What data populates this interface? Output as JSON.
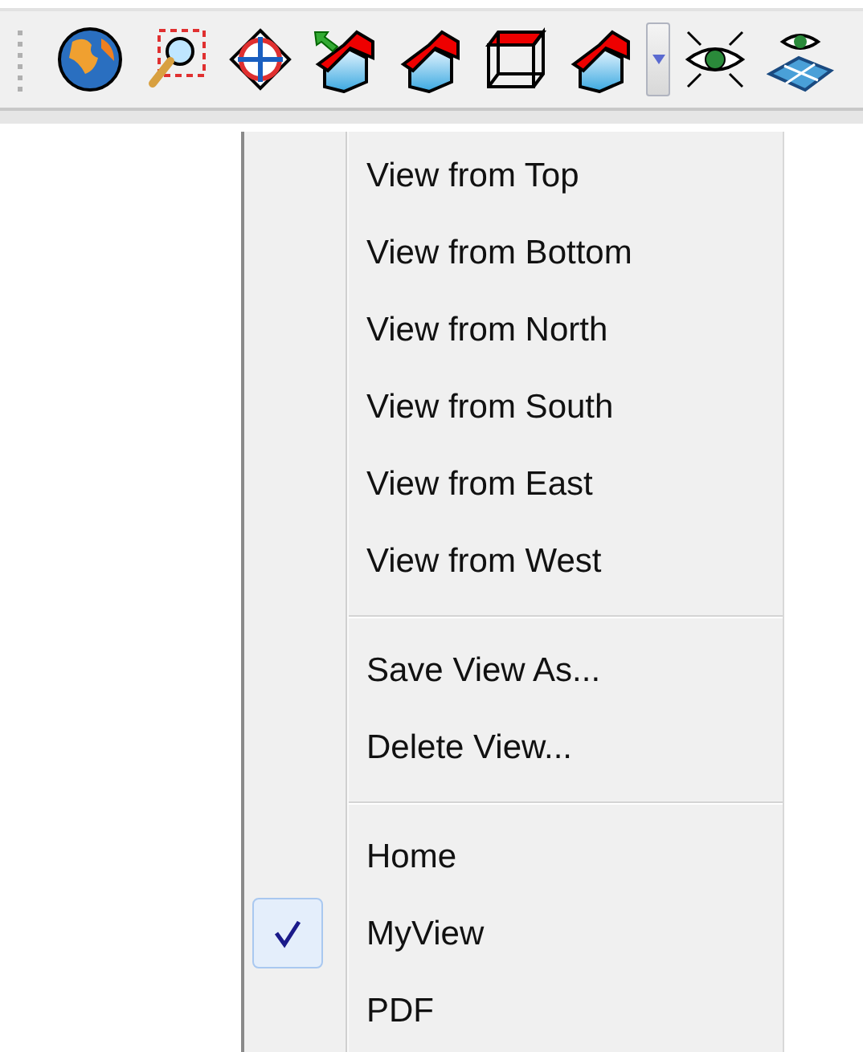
{
  "toolbar": {
    "buttons": [
      {
        "kind": "globe"
      },
      {
        "kind": "zoom-window"
      },
      {
        "kind": "zoom-extents"
      },
      {
        "kind": "house-arrow"
      },
      {
        "kind": "house"
      },
      {
        "kind": "box"
      },
      {
        "kind": "house"
      },
      {
        "kind": "dropdown"
      },
      {
        "kind": "eye-arrows"
      },
      {
        "kind": "eye-plane"
      }
    ]
  },
  "menu": {
    "sections": [
      {
        "items": [
          {
            "label": "View from Top",
            "checked": false
          },
          {
            "label": "View from Bottom",
            "checked": false
          },
          {
            "label": "View from North",
            "checked": false
          },
          {
            "label": "View from South",
            "checked": false
          },
          {
            "label": "View from East",
            "checked": false
          },
          {
            "label": "View from West",
            "checked": false
          }
        ]
      },
      {
        "items": [
          {
            "label": "Save View As...",
            "checked": false
          },
          {
            "label": "Delete View...",
            "checked": false
          }
        ]
      },
      {
        "items": [
          {
            "label": "Home",
            "checked": false
          },
          {
            "label": "MyView",
            "checked": true
          },
          {
            "label": "PDF",
            "checked": false
          }
        ]
      }
    ]
  }
}
